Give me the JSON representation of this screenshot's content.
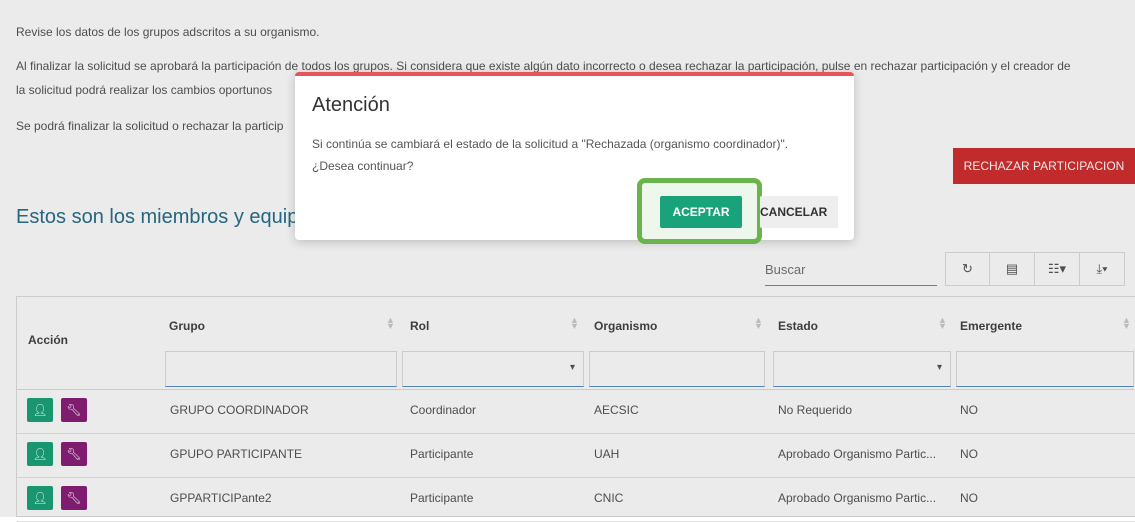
{
  "intro": {
    "line1": "Revise los datos de los grupos adscritos a su organismo.",
    "line2": "Al finalizar la solicitud se aprobará la participación de todos los grupos. Si considera que existe algún dato incorrecto o desea rechazar la participación, pulse en rechazar participación y el creador de",
    "line3": "la solicitud podrá realizar los cambios oportunos",
    "line4": "Se podrá finalizar la solicitud o rechazar la particip"
  },
  "reject_button": "RECHAZAR PARTICIPACION",
  "section_title": "Estos son los miembros y equipa",
  "search": {
    "placeholder": "Buscar"
  },
  "toolbar": {
    "refresh_icon": "refresh-icon",
    "list_icon": "list-icon",
    "columns_icon": "columns-icon",
    "export_icon": "export-icon"
  },
  "table": {
    "headers": [
      "Acción",
      "Grupo",
      "Rol",
      "Organismo",
      "Estado",
      "Emergente"
    ],
    "rows": [
      [
        "GRUPO COORDINADOR",
        "Coordinador",
        "AECSIC",
        "No Requerido",
        "NO"
      ],
      [
        "GPUPO PARTICIPANTE",
        "Participante",
        "UAH",
        "Aprobado Organismo Partic...",
        "NO"
      ],
      [
        "GPPARTICIPante2",
        "Participante",
        "CNIC",
        "Aprobado Organismo Partic...",
        "NO"
      ]
    ]
  },
  "modal": {
    "title": "Atención",
    "body1": "Si continúa se cambiará el estado de la solicitud a \"Rechazada (organismo coordinador)\".",
    "body2": "¿Desea continuar?",
    "accept": "ACEPTAR",
    "cancel": "CANCELAR"
  },
  "colors": {
    "accent_red": "#d32f2f",
    "green": "#1aa37a",
    "purple": "#8b1f7a",
    "title_blue": "#2a6f8a",
    "highlight": "#6bb34c"
  }
}
